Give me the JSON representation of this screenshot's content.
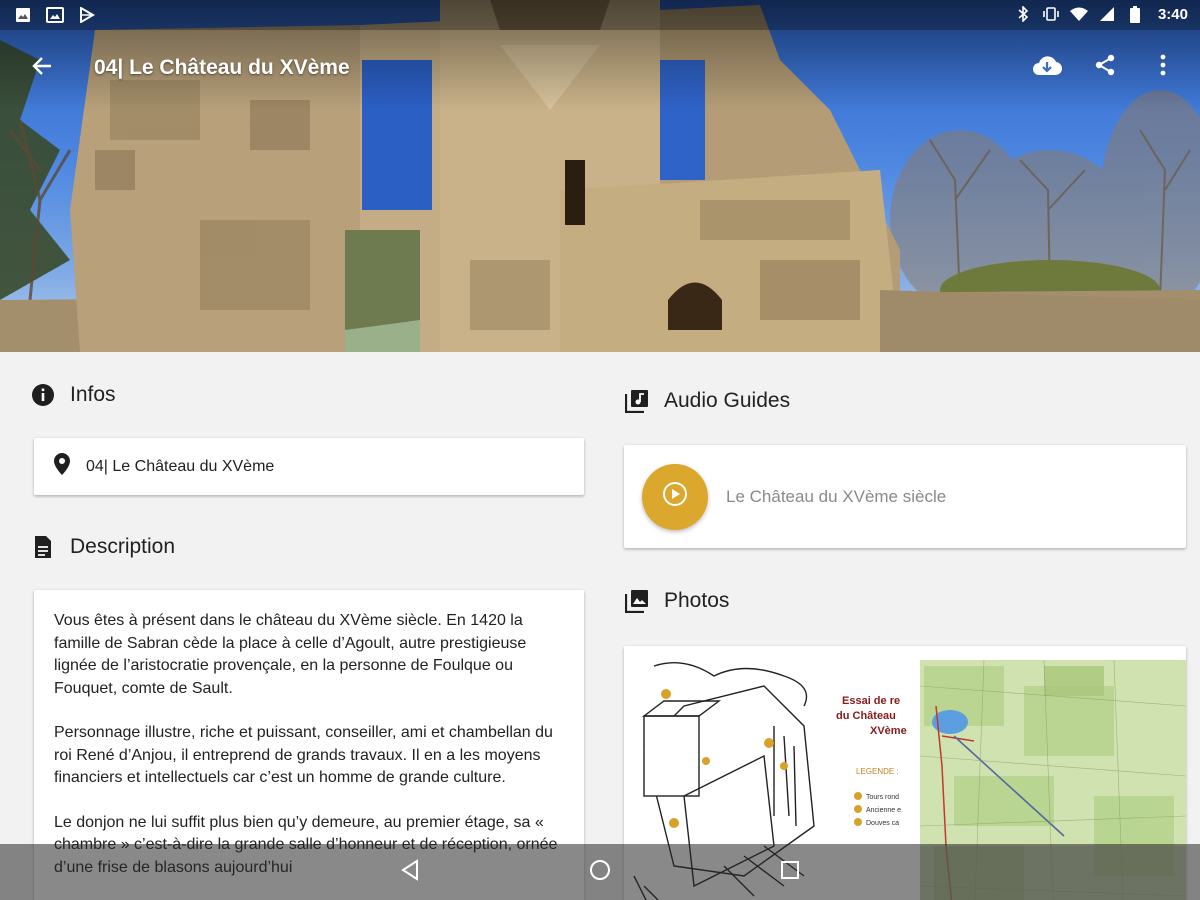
{
  "status_bar": {
    "time": "3:40",
    "left_icons": [
      "image-icon",
      "photo-icon",
      "play-store-icon"
    ],
    "right_icons": [
      "bluetooth-icon",
      "vibrate-icon",
      "wifi-icon",
      "signal-icon",
      "battery-icon"
    ]
  },
  "toolbar": {
    "title": "04| Le Château du XVème",
    "back_icon": "arrow-back-icon",
    "actions": [
      "cloud-download-icon",
      "share-icon",
      "more-vert-icon"
    ]
  },
  "infos": {
    "heading": "Infos",
    "location": "04| Le Château du XVème"
  },
  "description": {
    "heading": "Description",
    "paragraphs": [
      "Vous êtes à présent dans le château du XVème siècle. En 1420 la famille de Sabran cède la place à celle d’Agoult, autre prestigieuse lignée de l’aristocratie provençale, en la personne de Foulque ou Fouquet, comte de Sault.",
      "Personnage illustre, riche et puissant, conseiller, ami et chambellan du roi René d’Anjou, il entreprend de grands travaux. Il en a les moyens financiers et intellectuels car c’est un homme de grande culture.",
      "Le donjon ne lui suffit plus bien qu’y demeure, au premier étage, sa « chambre » c’est-à-dire la grande salle d’honneur et de réception, ornée d’une frise de blasons aujourd’hui"
    ]
  },
  "audio_guides": {
    "heading": "Audio Guides",
    "items": [
      {
        "label": "Le Château du XVème siècle"
      }
    ],
    "accent_color": "#dca72d"
  },
  "photos": {
    "heading": "Photos",
    "thumb_text": {
      "line1": "Essai de re",
      "line2": "du Château",
      "line3": "XVème",
      "legend": "LEGENDE :",
      "leg1": "Tours rond",
      "leg2": "Ancienne e",
      "leg3": "Douves ca"
    }
  },
  "nav_bar": {
    "buttons": [
      "back-nav-icon",
      "home-nav-icon",
      "recents-nav-icon"
    ]
  }
}
